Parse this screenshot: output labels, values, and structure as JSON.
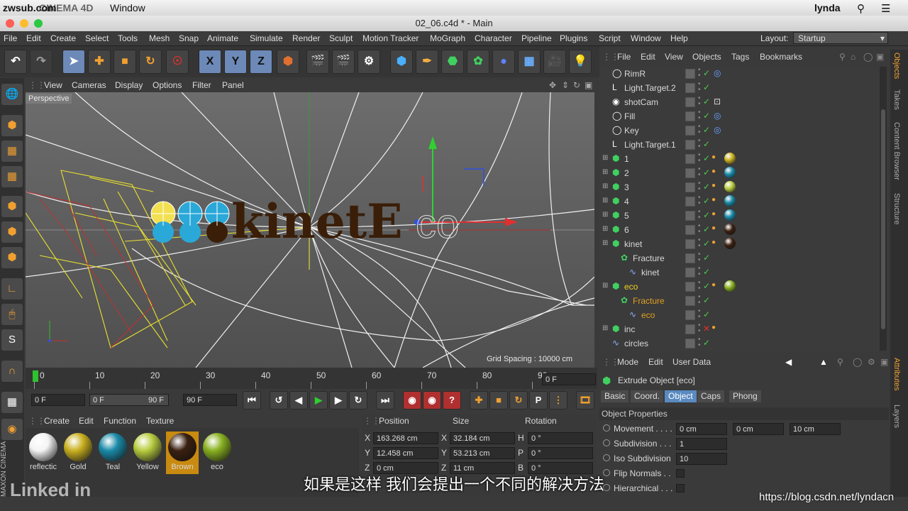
{
  "mac": {
    "overlay_brand": "zwsub.com",
    "app": "CINEMA 4D",
    "menu_window": "Window",
    "user": "lynda"
  },
  "window_title": "02_06.c4d * - Main",
  "app_menu": [
    "File",
    "Edit",
    "Create",
    "Select",
    "Tools",
    "Mesh",
    "Snap",
    "Animate",
    "Simulate",
    "Render",
    "Sculpt",
    "Motion Tracker",
    "MoGraph",
    "Character",
    "Pipeline",
    "Plugins",
    "Script",
    "Window",
    "Help"
  ],
  "layout": {
    "label": "Layout:",
    "value": "Startup"
  },
  "toolbar_axes": [
    "X",
    "Y",
    "Z"
  ],
  "viewport": {
    "menu": [
      "View",
      "Cameras",
      "Display",
      "Options",
      "Filter",
      "Panel"
    ],
    "label": "Perspective",
    "grid_spacing": "Grid Spacing : 10000 cm",
    "logo_text": "kinetE",
    "logo_tail": "co"
  },
  "timeline": {
    "ticks": [
      "0",
      "10",
      "20",
      "30",
      "40",
      "50",
      "60",
      "70",
      "80",
      "90"
    ],
    "current": "0 F"
  },
  "transport": {
    "start": "0 F",
    "range_start": "0 F",
    "range_end": "90 F",
    "end": "90 F"
  },
  "materials": {
    "menu": [
      "Create",
      "Edit",
      "Function",
      "Texture"
    ],
    "items": [
      {
        "name": "reflectic",
        "color": "#f4f4f4"
      },
      {
        "name": "Gold",
        "color": "#c9b020"
      },
      {
        "name": "Teal",
        "color": "#1a8aa8"
      },
      {
        "name": "Yellow",
        "color": "#b8cc40"
      },
      {
        "name": "Brown",
        "color": "#3a2010",
        "selected": true
      },
      {
        "name": "eco",
        "color": "#88b020"
      }
    ]
  },
  "coordinates": {
    "headers": [
      "Position",
      "Size",
      "Rotation"
    ],
    "rows": [
      {
        "axis": "X",
        "pos": "163.268 cm",
        "size_axis": "X",
        "size": "32.184 cm",
        "rot_axis": "H",
        "rot": "0 °"
      },
      {
        "axis": "Y",
        "pos": "12.458 cm",
        "size_axis": "Y",
        "size": "53.213 cm",
        "rot_axis": "P",
        "rot": "0 °"
      },
      {
        "axis": "Z",
        "pos": "0 cm",
        "size_axis": "Z",
        "size": "11 cm",
        "rot_axis": "B",
        "rot": "0 °"
      }
    ]
  },
  "objects": {
    "menu": [
      "File",
      "Edit",
      "View",
      "Objects",
      "Tags",
      "Bookmarks"
    ],
    "rows": [
      {
        "name": "RimR",
        "indent": 0,
        "icon": "light"
      },
      {
        "name": "Light.Target.2",
        "indent": 0,
        "icon": "null"
      },
      {
        "name": "shotCam",
        "indent": 0,
        "icon": "camera"
      },
      {
        "name": "Fill",
        "indent": 0,
        "icon": "light"
      },
      {
        "name": "Key",
        "indent": 0,
        "icon": "light"
      },
      {
        "name": "Light.Target.1",
        "indent": 0,
        "icon": "null"
      },
      {
        "name": "1",
        "indent": 0,
        "icon": "extrude",
        "mat": "#c9b020"
      },
      {
        "name": "2",
        "indent": 0,
        "icon": "extrude",
        "mat": "#1a8aa8"
      },
      {
        "name": "3",
        "indent": 0,
        "icon": "extrude",
        "mat": "#b8cc40"
      },
      {
        "name": "4",
        "indent": 0,
        "icon": "extrude",
        "mat": "#1a8aa8"
      },
      {
        "name": "5",
        "indent": 0,
        "icon": "extrude",
        "mat": "#1a8aa8"
      },
      {
        "name": "6",
        "indent": 0,
        "icon": "extrude",
        "mat": "#3a2010"
      },
      {
        "name": "kinet",
        "indent": 0,
        "icon": "extrude",
        "mat": "#3a2010"
      },
      {
        "name": "Fracture",
        "indent": 1,
        "icon": "fracture"
      },
      {
        "name": "kinet",
        "indent": 2,
        "icon": "spline"
      },
      {
        "name": "eco",
        "indent": 0,
        "icon": "extrude",
        "mat": "#88b020",
        "highlight": "#f0d020"
      },
      {
        "name": "Fracture",
        "indent": 1,
        "icon": "fracture",
        "highlight": "#e0a020"
      },
      {
        "name": "eco",
        "indent": 2,
        "icon": "spline",
        "highlight": "#e0a020"
      },
      {
        "name": "inc",
        "indent": 0,
        "icon": "extrude",
        "xmark": true
      },
      {
        "name": "circles",
        "indent": 0,
        "icon": "spline"
      }
    ]
  },
  "attributes": {
    "menu": [
      "Mode",
      "Edit",
      "User Data"
    ],
    "title": "Extrude Object [eco]",
    "tabs": [
      "Basic",
      "Coord.",
      "Object",
      "Caps",
      "Phong"
    ],
    "active_tab": "Object",
    "section": "Object Properties",
    "props": [
      {
        "label": "Movement . . . .",
        "v1": "0 cm",
        "v2": "0 cm",
        "v3": "10 cm"
      },
      {
        "label": "Subdivision . . .",
        "v1": "1"
      },
      {
        "label": "Iso Subdivision",
        "v1": "10"
      },
      {
        "label": "Flip Normals . ."
      },
      {
        "label": "Hierarchical . . ."
      }
    ]
  },
  "side_tabs": [
    "Objects",
    "Takes",
    "Content Browser",
    "Structure"
  ],
  "side_tabs_lower": [
    "Attributes",
    "Layers"
  ],
  "subtitle": "如果是这样  我们会提出一个不同的解决方法",
  "watermark": "https://blog.csdn.net/lyndacn",
  "brand": "Linked in"
}
